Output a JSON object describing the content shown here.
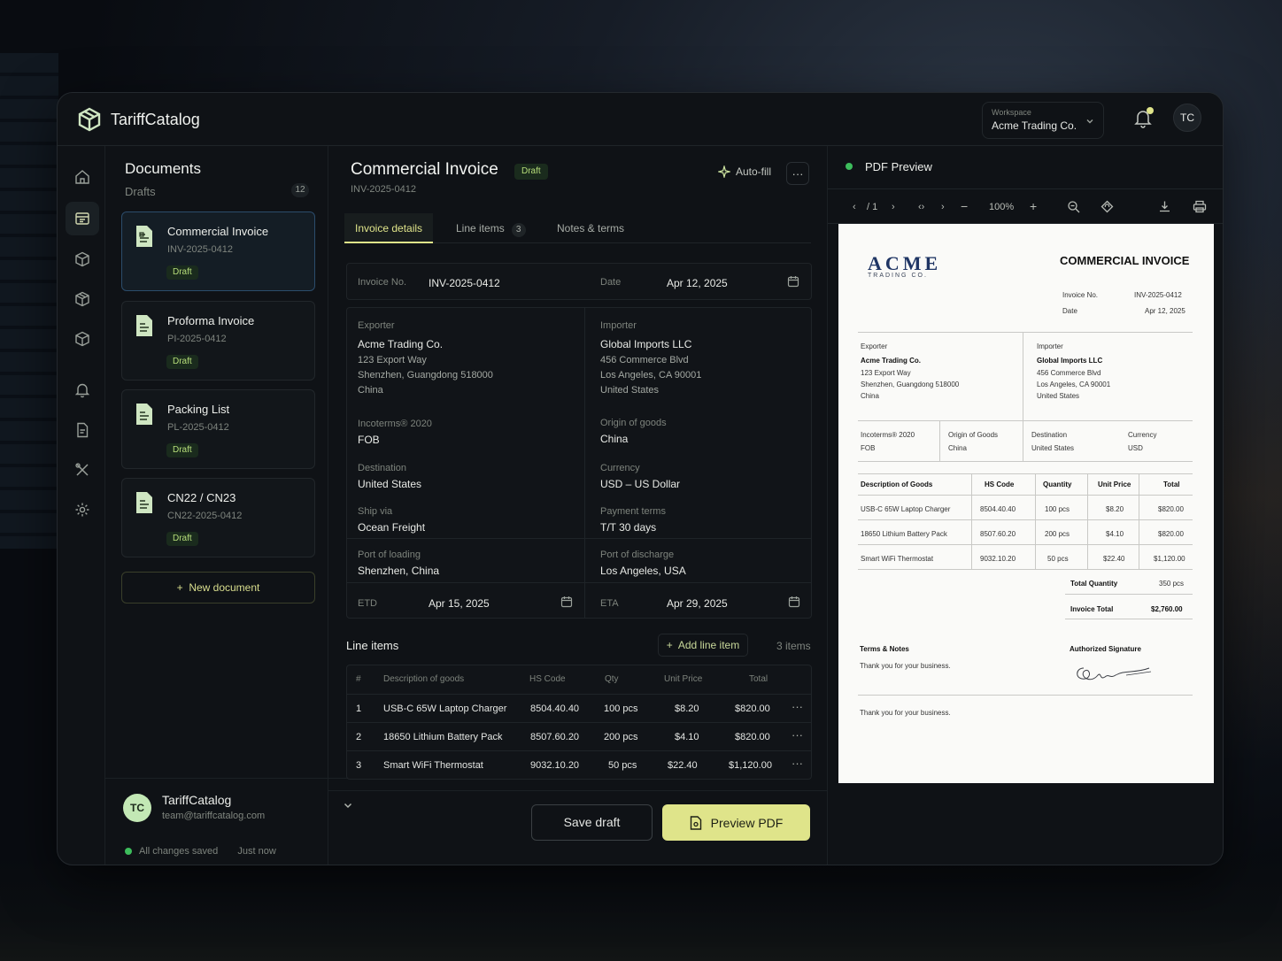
{
  "app": {
    "name": "TariffCatalog"
  },
  "workspace": {
    "label": "Workspace",
    "value": "Acme Trading Co."
  },
  "topbar": {
    "avatar": "TC"
  },
  "docs": {
    "title": "Documents",
    "subtitle": "Drafts",
    "count": "12",
    "items": [
      {
        "name": "Commercial Invoice",
        "id": "INV-2025-0412",
        "status": "Draft"
      },
      {
        "name": "Proforma Invoice",
        "id": "PI-2025-0412",
        "status": "Draft"
      },
      {
        "name": "Packing List",
        "id": "PL-2025-0412",
        "status": "Draft"
      },
      {
        "name": "CN22 / CN23",
        "id": "CN22-2025-0412",
        "status": "Draft"
      }
    ],
    "new_label": "New document"
  },
  "user": {
    "initials": "TC",
    "name": "TariffCatalog",
    "email": "team@tariffcatalog.com",
    "save_status": "All changes saved",
    "save_time": "Just now"
  },
  "invoice": {
    "title": "Commercial Invoice",
    "status": "Draft",
    "id": "INV-2025-0412",
    "autofill": "Auto-fill",
    "more": "···",
    "tabs": [
      {
        "label": "Invoice details"
      },
      {
        "label": "Line items",
        "count": "3"
      },
      {
        "label": "Notes & terms"
      }
    ],
    "invoice_no_label": "Invoice No.",
    "invoice_no": "INV-2025-0412",
    "date_label": "Date",
    "date": "Apr 12, 2025",
    "exporter": {
      "label": "Exporter",
      "name": "Acme Trading Co.",
      "addr1": "123 Export Way",
      "addr2": "Shenzhen, Guangdong 518000",
      "country": "China"
    },
    "importer": {
      "label": "Importer",
      "name": "Global Imports LLC",
      "addr1": "456 Commerce Blvd",
      "addr2": "Los Angeles, CA 90001",
      "country": "United States"
    },
    "incoterms": {
      "label": "Incoterms® 2020",
      "value": "FOB"
    },
    "origin": {
      "label": "Origin of goods",
      "value": "China"
    },
    "destination": {
      "label": "Destination",
      "value": "United States"
    },
    "currency": {
      "label": "Currency",
      "value": "USD – US Dollar"
    },
    "ship_via": {
      "label": "Ship via",
      "value": "Ocean Freight"
    },
    "payment": {
      "label": "Payment terms",
      "value": "T/T 30 days"
    },
    "pol": {
      "label": "Port of loading",
      "value": "Shenzhen, China"
    },
    "pod": {
      "label": "Port of discharge",
      "value": "Los Angeles, USA"
    },
    "etd": {
      "label": "ETD",
      "value": "Apr 15, 2025"
    },
    "eta": {
      "label": "ETA",
      "value": "Apr 29, 2025"
    }
  },
  "line_items": {
    "title": "Line items",
    "add_label": "Add line item",
    "count_text": "3 items",
    "headers": [
      "#",
      "Description of goods",
      "HS Code",
      "Qty",
      "Unit Price",
      "Total"
    ],
    "rows": [
      {
        "n": "1",
        "desc": "USB-C 65W Laptop Charger",
        "hs": "8504.40.40",
        "qty": "100 pcs",
        "price": "$8.20",
        "total": "$820.00"
      },
      {
        "n": "2",
        "desc": "18650 Lithium Battery Pack",
        "hs": "8507.60.20",
        "qty": "200 pcs",
        "price": "$4.10",
        "total": "$820.00"
      },
      {
        "n": "3",
        "desc": "Smart WiFi Thermostat",
        "hs": "9032.10.20",
        "qty": "50 pcs",
        "price": "$22.40",
        "total": "$1,120.00"
      }
    ]
  },
  "actions": {
    "save": "Save draft",
    "preview": "Preview PDF"
  },
  "preview": {
    "title": "PDF Preview",
    "page": "/ 1",
    "zoom": "100%",
    "paper": {
      "logo": "ACME",
      "logo_sub": "TRADING CO.",
      "heading": "COMMERCIAL INVOICE",
      "inv_label": "Invoice No.",
      "inv": "INV-2025-0412",
      "date_label": "Date",
      "date": "Apr 12, 2025",
      "exp_label": "Exporter",
      "exp_name": "Acme Trading Co.",
      "exp_a1": "123 Export Way",
      "exp_a2": "Shenzhen, Guangdong 518000",
      "exp_c": "China",
      "imp_label": "Importer",
      "imp_name": "Global Imports LLC",
      "imp_a1": "456 Commerce Blvd",
      "imp_a2": "Los Angeles, CA 90001",
      "imp_c": "United States",
      "inco_label": "Incoterms® 2020",
      "inco": "FOB",
      "orig_label": "Origin of Goods",
      "orig": "China",
      "dest_label": "Destination",
      "dest": "United States",
      "cur_label": "Currency",
      "cur": "USD",
      "headers": [
        "Description of Goods",
        "HS Code",
        "Quantity",
        "Unit Price",
        "Total"
      ],
      "rows": [
        {
          "desc": "USB-C 65W Laptop Charger",
          "hs": "8504.40.40",
          "qty": "100 pcs",
          "price": "$8.20",
          "total": "$820.00"
        },
        {
          "desc": "18650 Lithium Battery Pack",
          "hs": "8507.60.20",
          "qty": "200 pcs",
          "price": "$4.10",
          "total": "$820.00"
        },
        {
          "desc": "Smart WiFi Thermostat",
          "hs": "9032.10.20",
          "qty": "50 pcs",
          "price": "$22.40",
          "total": "$1,120.00"
        }
      ],
      "total_qty_label": "Total Quantity",
      "total_qty": "350 pcs",
      "total_label": "Invoice Total",
      "total": "$2,760.00",
      "terms_label": "Terms & Notes",
      "terms": "Thank you for your business.",
      "sig_label": "Authorized Signature",
      "footer": "Thank you for your business."
    }
  },
  "colors": {
    "accent": "#dfe48a",
    "success": "#3dbd5c",
    "draft_badge": "#b7de7a",
    "brand_navy": "#1f3564"
  }
}
